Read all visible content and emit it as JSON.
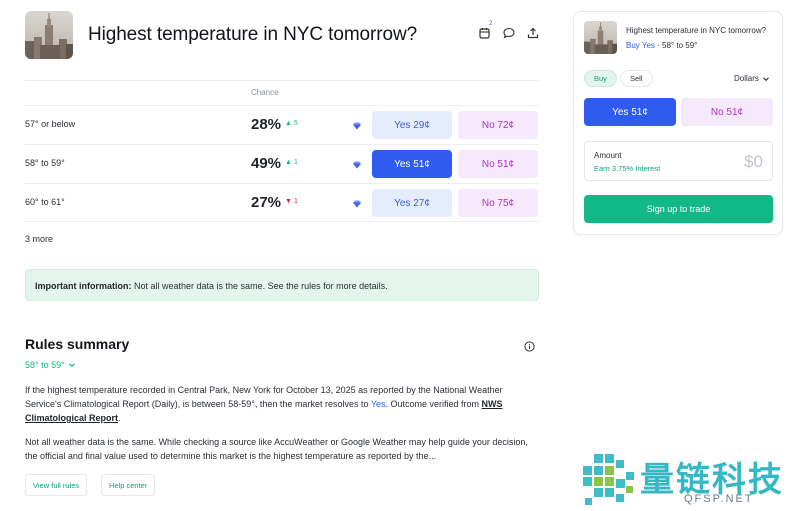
{
  "header": {
    "title": "Highest temperature in NYC tomorrow?",
    "calendar_badge": "2",
    "icons": [
      "calendar-icon",
      "comment-icon",
      "share-icon"
    ]
  },
  "table": {
    "chance_header": "Chance",
    "rows": [
      {
        "label": "57° or below",
        "chance": "28%",
        "delta": "5",
        "direction": "up",
        "yes": "Yes 29¢",
        "no": "No 72¢",
        "yes_active": false
      },
      {
        "label": "58° to 59°",
        "chance": "49%",
        "delta": "1",
        "direction": "up",
        "yes": "Yes 51¢",
        "no": "No 51¢",
        "yes_active": true
      },
      {
        "label": "60° to 61°",
        "chance": "27%",
        "delta": "1",
        "direction": "down",
        "yes": "Yes 27¢",
        "no": "No 75¢",
        "yes_active": false
      }
    ],
    "more": "3 more"
  },
  "banner": {
    "bold": "Important information:",
    "text": " Not all weather data is the same. See the rules for more details."
  },
  "rules": {
    "title": "Rules summary",
    "range": "58° to 59°",
    "p1_a": "If the highest temperature recorded in Central Park, New York for October 13, 2025 as reported by the National Weather Service's Climatological Report (Daily), is between 58-59°, then the market resolves to ",
    "p1_yes": "Yes",
    "p1_b": ". Outcome verified from ",
    "p1_link": "NWS Climatological Report",
    "p1_c": ".",
    "p2": "Not all weather data is the same. While checking a source like AccuWeather or Google Weather may help guide your decision, the official and final value used to determine this market is the highest temperature as reported by the...",
    "view_full": "View full rules",
    "help": "Help center"
  },
  "trade": {
    "title": "Highest temperature in NYC tomorrow?",
    "buy_side": "Buy Yes",
    "sep": " · ",
    "range": "58° to 59°",
    "tab_buy": "Buy",
    "tab_sell": "Sell",
    "currency": "Dollars",
    "yes": "Yes 51¢",
    "no": "No 51¢",
    "amount_label": "Amount",
    "interest": "Earn 3.75% Interest",
    "amount_value": "$0",
    "signup": "Sign up to trade"
  },
  "watermark": {
    "cn": "量链科技",
    "en": "QFSP.NET"
  },
  "colors": {
    "accent_blue": "#2f5bf0",
    "yes_bg": "#e4ecfd",
    "no_bg": "#f5e9fb",
    "no_text": "#b232c9",
    "green": "#10b981",
    "red": "#e11d48",
    "signup": "#12b886"
  }
}
